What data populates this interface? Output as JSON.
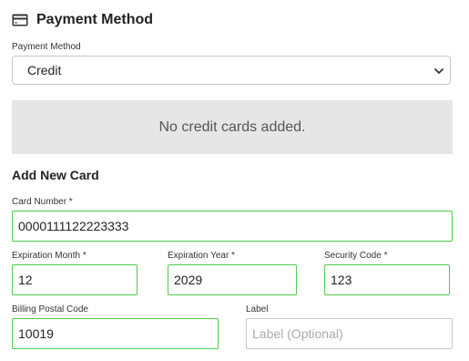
{
  "header": {
    "title": "Payment Method",
    "icon": "credit-card-icon"
  },
  "payment_method": {
    "label": "Payment Method",
    "selected": "Credit"
  },
  "cards": {
    "empty_message": "No credit cards added."
  },
  "new_card": {
    "heading": "Add New Card",
    "card_number": {
      "label": "Card Number *",
      "value": "0000111122223333"
    },
    "exp_month": {
      "label": "Expiration Month *",
      "value": "12"
    },
    "exp_year": {
      "label": "Expiration Year *",
      "value": "2029"
    },
    "security_code": {
      "label": "Security Code *",
      "value": "123"
    },
    "postal_code": {
      "label": "Billing Postal Code",
      "value": "10019"
    },
    "card_label": {
      "label": "Label",
      "placeholder": "Label (Optional)",
      "value": ""
    }
  },
  "colors": {
    "valid_border": "#4ccc4c",
    "empty_box_bg": "#e6e6e6"
  }
}
